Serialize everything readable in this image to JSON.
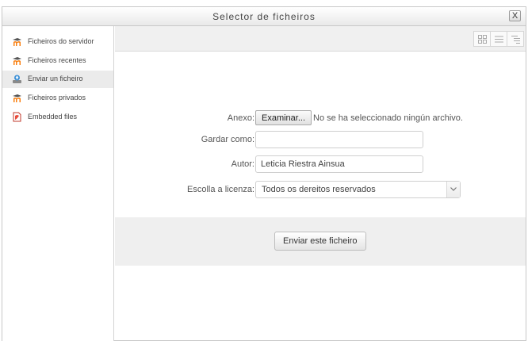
{
  "dialog": {
    "title": "Selector de ficheiros",
    "close_label": "X"
  },
  "sidebar": {
    "items": [
      {
        "label": "Ficheiros do servidor",
        "icon": "moodle-repository-icon"
      },
      {
        "label": "Ficheiros recentes",
        "icon": "moodle-repository-icon"
      },
      {
        "label": "Enviar un ficheiro",
        "icon": "upload-icon",
        "active": true
      },
      {
        "label": "Ficheiros privados",
        "icon": "moodle-repository-icon"
      },
      {
        "label": "Embedded files",
        "icon": "document-icon"
      }
    ]
  },
  "toolbar": {
    "views": [
      "icon-view-icon",
      "list-view-icon",
      "tree-view-icon"
    ]
  },
  "form": {
    "attachment_label": "Anexo:",
    "browse_label": "Examinar...",
    "no_file_text": "No se ha seleccionado ningún archivo.",
    "save_as_label": "Gardar como:",
    "save_as_value": "",
    "author_label": "Autor:",
    "author_value": "Leticia Riestra Ainsua",
    "license_label": "Escolla a licenza:",
    "license_value": "Todos os dereitos reservados",
    "submit_label": "Enviar este ficheiro"
  },
  "colors": {
    "active_item_bg": "#ebebeb",
    "moodle_orange": "#f98012",
    "band_bg": "#efefef"
  }
}
